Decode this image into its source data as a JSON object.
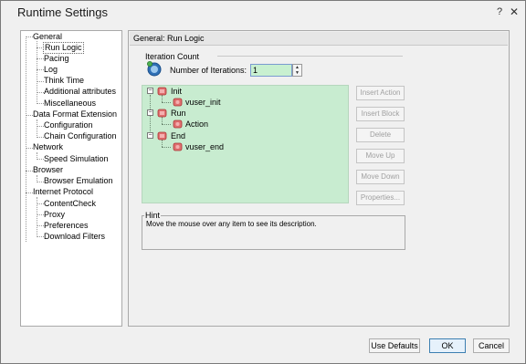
{
  "window": {
    "title": "Runtime Settings",
    "help": "?",
    "close": "✕"
  },
  "nav": {
    "items": [
      {
        "label": "General"
      },
      {
        "label": "Run Logic"
      },
      {
        "label": "Pacing"
      },
      {
        "label": "Log"
      },
      {
        "label": "Think Time"
      },
      {
        "label": "Additional attributes"
      },
      {
        "label": "Miscellaneous"
      },
      {
        "label": "Data Format Extension"
      },
      {
        "label": "Configuration"
      },
      {
        "label": "Chain Configuration"
      },
      {
        "label": "Network"
      },
      {
        "label": "Speed Simulation"
      },
      {
        "label": "Browser"
      },
      {
        "label": "Browser Emulation"
      },
      {
        "label": "Internet Protocol"
      },
      {
        "label": "ContentCheck"
      },
      {
        "label": "Proxy"
      },
      {
        "label": "Preferences"
      },
      {
        "label": "Download Filters"
      }
    ]
  },
  "panel": {
    "title": "General: Run Logic",
    "iteration_group": "Iteration Count",
    "iterations_label": "Number of Iterations:",
    "iterations_value": "1",
    "tree": [
      {
        "label": "Init"
      },
      {
        "label": "vuser_init"
      },
      {
        "label": "Run"
      },
      {
        "label": "Action"
      },
      {
        "label": "End"
      },
      {
        "label": "vuser_end"
      }
    ],
    "buttons": {
      "insert_action": "Insert Action",
      "insert_block": "Insert Block",
      "delete": "Delete",
      "move_up": "Move Up",
      "move_down": "Move Down",
      "properties": "Properties..."
    },
    "hint_label": "Hint",
    "hint_text": "Move the mouse over any item to see its description."
  },
  "footer": {
    "use_defaults": "Use Defaults",
    "ok": "OK",
    "cancel": "Cancel"
  },
  "colors": {
    "tree_bg": "#c8ecd0",
    "input_bg": "#c8f0d0",
    "accent": "#3c7fb1"
  }
}
